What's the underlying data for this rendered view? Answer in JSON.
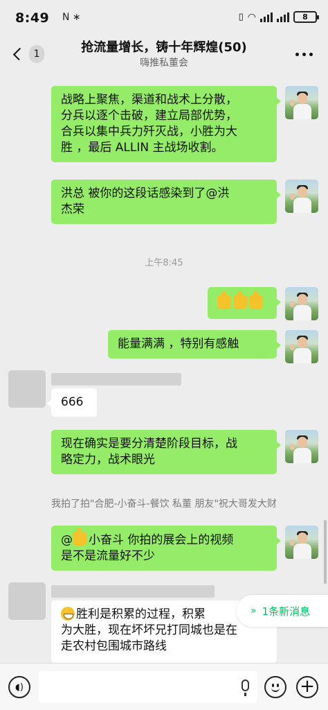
{
  "status_bar": {
    "time": "8:49",
    "left_icons": "N ∗",
    "battery": "8"
  },
  "header": {
    "back_badge": "1",
    "title": "抢流量增长，铸十年辉煌(50)",
    "subtitle": "嗨推私董会"
  },
  "messages": [
    {
      "id": "m1",
      "side": "right",
      "lines": [
        "战略上聚焦，渠道和战术上分散，",
        "分兵以逐个击破，建立局部优势，",
        "合兵以集中兵力歼灭战，小胜为大",
        "胜 ，最后 ALLIN 主战场收割。"
      ]
    },
    {
      "id": "m2",
      "side": "right",
      "lines": [
        "洪总  被你的这段话感染到了@洪",
        "杰荣"
      ]
    },
    {
      "id": "ts1",
      "type": "timestamp",
      "text": "上午8:45"
    },
    {
      "id": "m3",
      "side": "right",
      "lines": [
        "thumbs-up ×3"
      ]
    },
    {
      "id": "m4",
      "side": "right",
      "lines": [
        "能量满满 ，特别有感触"
      ]
    },
    {
      "id": "m5",
      "side": "left",
      "lines": [
        "666"
      ]
    },
    {
      "id": "m6",
      "side": "right",
      "lines": [
        "现在确实是要分清楚阶段目标，战",
        "略定力，战术眼光"
      ]
    },
    {
      "id": "sys1",
      "type": "system",
      "text": "我拍了拍\"合肥-小奋斗-餐饮 私董  朋友\"祝大哥发大财"
    },
    {
      "id": "m7",
      "side": "right",
      "prefix": "@",
      "mention": "小奋斗",
      "line1_rest": "  你拍的展会上的视频",
      "line2": "是不是流量好不少"
    },
    {
      "id": "m8",
      "side": "left",
      "line1": "胜利是积累的过程，积累",
      "line2": "为大胜，现在坏坏兄打同城也是在",
      "line3": "走农村包围城市路线"
    }
  ],
  "new_message_pill": "1条新消息",
  "icons": {
    "back": "chevron-left-icon",
    "more": "more-dots-icon",
    "voice": "voice-icon",
    "mic": "mic-icon",
    "emoji": "emoji-icon",
    "plus": "plus-icon"
  },
  "colors": {
    "bubble_self": "#95ec69",
    "bubble_other": "#ffffff",
    "chat_bg": "#ededed",
    "accent_green": "#07c160"
  }
}
